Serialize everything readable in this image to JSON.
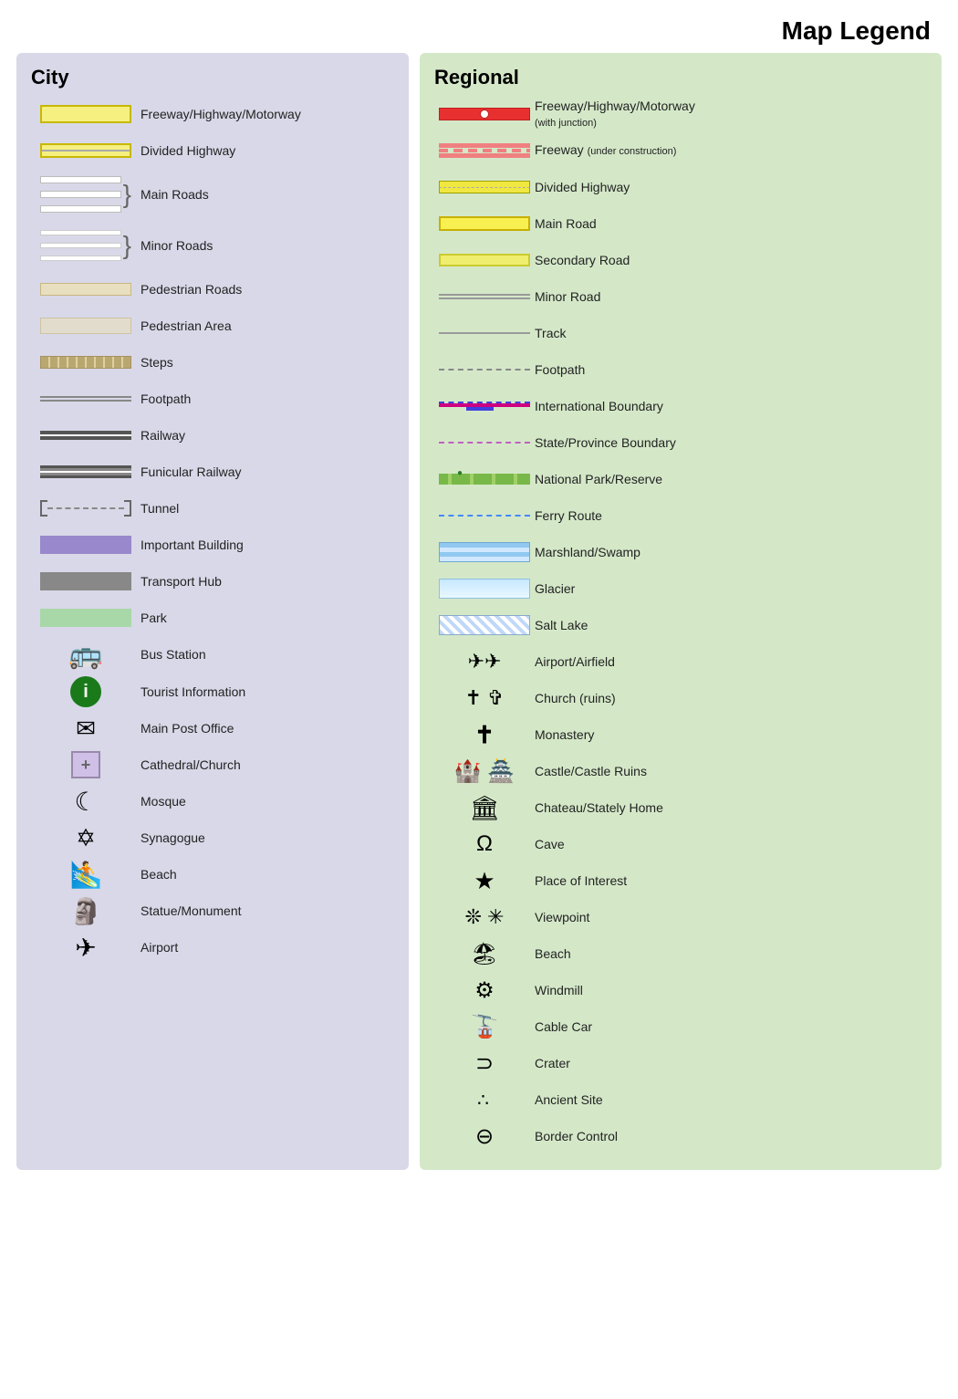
{
  "title": "Map Legend",
  "city": {
    "heading": "City",
    "items": [
      {
        "label": "Freeway/Highway/Motorway",
        "type": "road-freeway"
      },
      {
        "label": "Divided Highway",
        "type": "road-divided"
      },
      {
        "label": "Main Roads",
        "type": "road-main"
      },
      {
        "label": "Minor Roads",
        "type": "road-minor"
      },
      {
        "label": "Pedestrian Roads",
        "type": "pedestrian-roads"
      },
      {
        "label": "Pedestrian Area",
        "type": "pedestrian-area"
      },
      {
        "label": "Steps",
        "type": "steps"
      },
      {
        "label": "Footpath",
        "type": "footpath"
      },
      {
        "label": "Railway",
        "type": "railway"
      },
      {
        "label": "Funicular Railway",
        "type": "funicular"
      },
      {
        "label": "Tunnel",
        "type": "tunnel"
      },
      {
        "label": "Important Building",
        "type": "important-building"
      },
      {
        "label": "Transport Hub",
        "type": "transport-hub"
      },
      {
        "label": "Park",
        "type": "park"
      },
      {
        "label": "Bus Station",
        "type": "icon-bus"
      },
      {
        "label": "Tourist Information",
        "type": "icon-info"
      },
      {
        "label": "Main Post Office",
        "type": "icon-mail"
      },
      {
        "label": "Cathedral/Church",
        "type": "icon-church"
      },
      {
        "label": "Mosque",
        "type": "icon-mosque"
      },
      {
        "label": "Synagogue",
        "type": "icon-synagogue"
      },
      {
        "label": "Beach",
        "type": "icon-beach"
      },
      {
        "label": "Statue/Monument",
        "type": "icon-statue"
      },
      {
        "label": "Airport",
        "type": "icon-airport"
      }
    ]
  },
  "regional": {
    "heading": "Regional",
    "items": [
      {
        "label": "Freeway/Highway/Motorway",
        "sublabel": "(with junction)",
        "type": "reg-freeway"
      },
      {
        "label": "Freeway",
        "sublabel": "(under construction)",
        "type": "reg-freeway-construct"
      },
      {
        "label": "Divided Highway",
        "type": "reg-divided"
      },
      {
        "label": "Main Road",
        "type": "reg-mainroad"
      },
      {
        "label": "Secondary Road",
        "type": "reg-secondary"
      },
      {
        "label": "Minor Road",
        "type": "reg-minor"
      },
      {
        "label": "Track",
        "type": "reg-track"
      },
      {
        "label": "Footpath",
        "type": "reg-footpath"
      },
      {
        "label": "International Boundary",
        "type": "reg-intl"
      },
      {
        "label": "State/Province Boundary",
        "type": "reg-state"
      },
      {
        "label": "National Park/Reserve",
        "type": "reg-natpark"
      },
      {
        "label": "Ferry Route",
        "type": "reg-ferry"
      },
      {
        "label": "Marshland/Swamp",
        "type": "reg-marsh"
      },
      {
        "label": "Glacier",
        "type": "reg-glacier"
      },
      {
        "label": "Salt Lake",
        "type": "reg-saltlake"
      },
      {
        "label": "Airport/Airfield",
        "type": "reg-airport"
      },
      {
        "label": "Church (ruins)",
        "type": "reg-church"
      },
      {
        "label": "Monastery",
        "type": "reg-monastery"
      },
      {
        "label": "Castle/Castle Ruins",
        "type": "reg-castle"
      },
      {
        "label": "Chateau/Stately Home",
        "type": "reg-chateau"
      },
      {
        "label": "Cave",
        "type": "reg-cave"
      },
      {
        "label": "Place of Interest",
        "type": "reg-poi"
      },
      {
        "label": "Viewpoint",
        "type": "reg-viewpoint"
      },
      {
        "label": "Beach",
        "type": "reg-beach"
      },
      {
        "label": "Windmill",
        "type": "reg-windmill"
      },
      {
        "label": "Cable Car",
        "type": "reg-cablecar"
      },
      {
        "label": "Crater",
        "type": "reg-crater"
      },
      {
        "label": "Ancient Site",
        "type": "reg-ancient"
      },
      {
        "label": "Border Control",
        "type": "reg-border"
      }
    ]
  }
}
